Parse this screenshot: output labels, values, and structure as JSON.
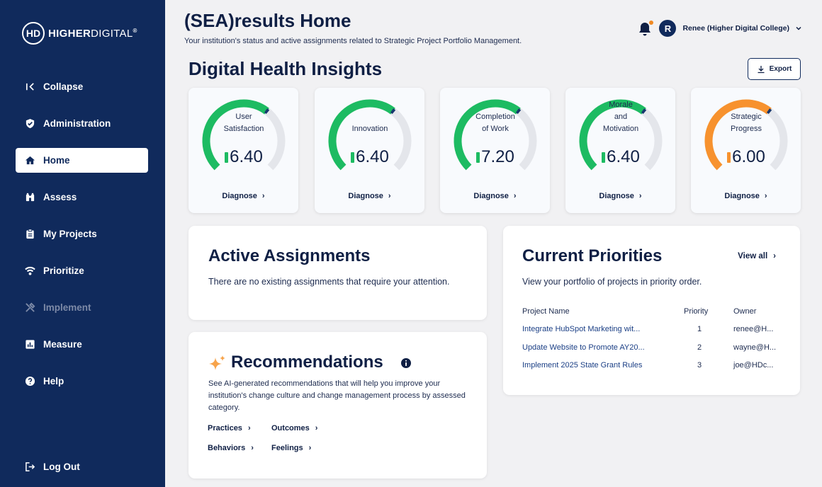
{
  "brand": {
    "logo_mark": "HD",
    "name_bold": "HIGHER",
    "name_thin": "DIGITAL",
    "reg": "®"
  },
  "sidebar": {
    "items": [
      {
        "label": "Collapse",
        "icon": "collapse-icon"
      },
      {
        "label": "Administration",
        "icon": "shield-icon"
      },
      {
        "label": "Home",
        "icon": "home-icon",
        "active": true
      },
      {
        "label": "Assess",
        "icon": "binoculars-icon"
      },
      {
        "label": "My Projects",
        "icon": "clipboard-icon"
      },
      {
        "label": "Prioritize",
        "icon": "signal-icon"
      },
      {
        "label": "Implement",
        "icon": "tools-icon",
        "disabled": true
      },
      {
        "label": "Measure",
        "icon": "chart-icon"
      },
      {
        "label": "Help",
        "icon": "help-icon"
      }
    ],
    "logout": "Log Out"
  },
  "header": {
    "title": "(SEA)results Home",
    "subtitle": "Your institution's status and active assignments related to Strategic Project Portfolio Management.",
    "avatar_initial": "R",
    "user_name": "Renee (Higher Digital College)"
  },
  "insights": {
    "title": "Digital Health Insights",
    "export_label": "Export",
    "diagnose_label": "Diagnose",
    "gauges": [
      {
        "label_lines": [
          "User",
          "Satisfaction"
        ],
        "value": "6.40",
        "fraction": 0.64,
        "color": "#1dbb62"
      },
      {
        "label_lines": [
          "Innovation"
        ],
        "value": "6.40",
        "fraction": 0.64,
        "color": "#1dbb62"
      },
      {
        "label_lines": [
          "Completion",
          "of Work"
        ],
        "value": "7.20",
        "fraction": 0.64,
        "color": "#1dbb62"
      },
      {
        "label_lines": [
          "Morale",
          "and",
          "Motivation"
        ],
        "value": "6.40",
        "fraction": 0.64,
        "color": "#1dbb62"
      },
      {
        "label_lines": [
          "Strategic",
          "Progress"
        ],
        "value": "6.00",
        "fraction": 0.64,
        "color": "#f7922e"
      }
    ]
  },
  "assignments": {
    "title": "Active Assignments",
    "message": "There are no existing assignments that require your attention."
  },
  "recommendations": {
    "title": "Recommendations",
    "description": "See AI-generated recommendations that will help you improve your institution's change culture and change management process by assessed category.",
    "links": [
      "Practices",
      "Outcomes",
      "Behaviors",
      "Feelings"
    ]
  },
  "priorities": {
    "title": "Current Priorities",
    "view_all": "View all",
    "description": "View your portfolio of projects in priority order.",
    "columns": [
      "Project Name",
      "Priority",
      "Owner"
    ],
    "rows": [
      {
        "name": "Integrate HubSpot Marketing wit...",
        "priority": "1",
        "owner": "renee@H..."
      },
      {
        "name": "Update Website to Promote AY20...",
        "priority": "2",
        "owner": "wayne@H..."
      },
      {
        "name": "Implement 2025 State Grant Rules",
        "priority": "3",
        "owner": "joe@HDc..."
      }
    ]
  },
  "colors": {
    "sidebar": "#102a5c",
    "accent_green": "#1dbb62",
    "accent_orange": "#f7922e",
    "gauge_track": "#e4e6eb",
    "gauge_tick": "#17376e"
  }
}
